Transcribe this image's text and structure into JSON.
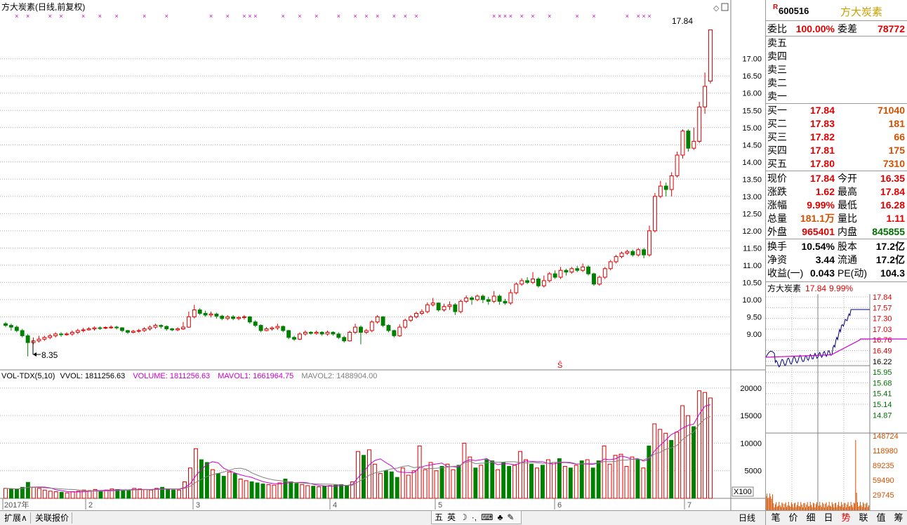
{
  "header": {
    "stock_name": "方大炭素",
    "chart_mode": "(日线,前复权)",
    "r_badge": "R",
    "code": "600516"
  },
  "chart_data": [
    {
      "type": "candlestick",
      "title": "方大炭素(日线,前复权)",
      "y_ticks": [
        9.0,
        9.5,
        10.0,
        10.5,
        11.0,
        11.5,
        12.0,
        12.5,
        13.0,
        13.5,
        14.0,
        14.5,
        15.0,
        15.5,
        16.0,
        16.5,
        17.0
      ],
      "ylim": [
        8.1,
        18.3
      ],
      "annotations": {
        "high_label": "17.84",
        "low_label": "8.35"
      },
      "candles": [
        [
          9.3,
          9.25,
          9.35,
          9.2
        ],
        [
          9.25,
          9.2,
          9.3,
          9.1
        ],
        [
          9.2,
          9.1,
          9.25,
          9.05
        ],
        [
          9.1,
          8.95,
          9.15,
          8.9
        ],
        [
          8.95,
          8.75,
          9.0,
          8.35
        ],
        [
          8.75,
          8.8,
          8.9,
          8.7
        ],
        [
          8.8,
          8.85,
          8.95,
          8.75
        ],
        [
          8.85,
          8.9,
          8.95,
          8.8
        ],
        [
          8.9,
          8.95,
          9.0,
          8.85
        ],
        [
          8.95,
          9.0,
          9.05,
          8.9
        ],
        [
          9.0,
          8.98,
          9.05,
          8.92
        ],
        [
          8.98,
          9.0,
          9.05,
          8.95
        ],
        [
          9.0,
          9.05,
          9.1,
          8.95
        ],
        [
          9.05,
          9.1,
          9.15,
          9.0
        ],
        [
          9.1,
          9.12,
          9.18,
          9.05
        ],
        [
          9.12,
          9.15,
          9.2,
          9.1
        ],
        [
          9.15,
          9.18,
          9.22,
          9.1
        ],
        [
          9.18,
          9.17,
          9.22,
          9.12
        ],
        [
          9.17,
          9.19,
          9.22,
          9.14
        ],
        [
          9.19,
          9.2,
          9.25,
          9.15
        ],
        [
          9.2,
          9.18,
          9.24,
          9.13
        ],
        [
          9.18,
          9.1,
          9.2,
          9.05
        ],
        [
          9.1,
          9.05,
          9.12,
          9.0
        ],
        [
          9.05,
          9.08,
          9.12,
          9.02
        ],
        [
          9.08,
          9.1,
          9.15,
          9.04
        ],
        [
          9.1,
          9.15,
          9.2,
          9.06
        ],
        [
          9.15,
          9.2,
          9.25,
          9.1
        ],
        [
          9.2,
          9.25,
          9.3,
          9.15
        ],
        [
          9.25,
          9.22,
          9.28,
          9.16
        ],
        [
          9.22,
          9.15,
          9.25,
          9.1
        ],
        [
          9.15,
          9.12,
          9.18,
          9.08
        ],
        [
          9.12,
          9.15,
          9.2,
          9.08
        ],
        [
          9.15,
          9.2,
          9.35,
          9.12
        ],
        [
          9.2,
          9.5,
          9.65,
          9.18
        ],
        [
          9.5,
          9.7,
          9.85,
          9.45
        ],
        [
          9.7,
          9.6,
          9.75,
          9.55
        ],
        [
          9.6,
          9.55,
          9.68,
          9.5
        ],
        [
          9.55,
          9.58,
          9.65,
          9.48
        ],
        [
          9.58,
          9.52,
          9.62,
          9.45
        ],
        [
          9.52,
          9.45,
          9.56,
          9.4
        ],
        [
          9.45,
          9.5,
          9.55,
          9.4
        ],
        [
          9.5,
          9.45,
          9.55,
          9.4
        ],
        [
          9.45,
          9.48,
          9.52,
          9.4
        ],
        [
          9.48,
          9.5,
          9.55,
          9.42
        ],
        [
          9.5,
          9.35,
          9.52,
          9.3
        ],
        [
          9.35,
          9.25,
          9.4,
          9.2
        ],
        [
          9.25,
          9.1,
          9.28,
          9.05
        ],
        [
          9.1,
          9.15,
          9.2,
          9.08
        ],
        [
          9.15,
          9.18,
          9.22,
          9.1
        ],
        [
          9.18,
          9.22,
          9.3,
          9.12
        ],
        [
          9.22,
          9.1,
          9.25,
          9.05
        ],
        [
          9.1,
          8.9,
          9.12,
          8.85
        ],
        [
          8.9,
          8.85,
          8.95,
          8.8
        ],
        [
          8.85,
          9.0,
          9.05,
          8.82
        ],
        [
          9.0,
          9.05,
          9.1,
          8.95
        ],
        [
          9.05,
          9.02,
          9.08,
          8.98
        ],
        [
          9.02,
          9.05,
          9.1,
          8.98
        ],
        [
          9.05,
          9.0,
          9.08,
          8.95
        ],
        [
          9.0,
          9.05,
          9.1,
          8.95
        ],
        [
          9.05,
          9.0,
          9.08,
          8.95
        ],
        [
          9.0,
          8.9,
          9.05,
          8.85
        ],
        [
          8.9,
          8.8,
          8.95,
          8.75
        ],
        [
          8.8,
          9.05,
          9.1,
          8.78
        ],
        [
          9.05,
          9.2,
          9.3,
          9.0
        ],
        [
          9.2,
          9.05,
          9.25,
          8.7
        ],
        [
          9.05,
          9.1,
          9.15,
          9.0
        ],
        [
          9.1,
          9.35,
          9.4,
          9.05
        ],
        [
          9.35,
          9.5,
          9.55,
          9.3
        ],
        [
          9.5,
          9.25,
          9.52,
          9.2
        ],
        [
          9.25,
          9.1,
          9.28,
          9.05
        ],
        [
          9.1,
          8.95,
          9.12,
          8.9
        ],
        [
          8.95,
          9.2,
          9.28,
          8.92
        ],
        [
          9.2,
          9.4,
          9.45,
          9.15
        ],
        [
          9.4,
          9.5,
          9.55,
          9.35
        ],
        [
          9.5,
          9.6,
          9.65,
          9.45
        ],
        [
          9.6,
          9.65,
          9.72,
          9.55
        ],
        [
          9.65,
          9.85,
          9.92,
          9.6
        ],
        [
          9.85,
          9.9,
          10.05,
          9.8
        ],
        [
          9.9,
          9.7,
          9.92,
          9.65
        ],
        [
          9.7,
          9.8,
          9.88,
          9.65
        ],
        [
          9.8,
          9.85,
          9.95,
          9.7
        ],
        [
          9.85,
          9.65,
          9.9,
          9.55
        ],
        [
          9.65,
          9.95,
          10.0,
          9.6
        ],
        [
          9.95,
          10.05,
          10.12,
          9.9
        ],
        [
          10.05,
          10.0,
          10.1,
          9.85
        ],
        [
          10.0,
          10.1,
          10.15,
          9.95
        ],
        [
          10.1,
          10.0,
          10.15,
          9.9
        ],
        [
          10.0,
          9.95,
          10.08,
          9.85
        ],
        [
          9.95,
          10.1,
          10.25,
          9.9
        ],
        [
          10.1,
          9.95,
          10.15,
          9.85
        ],
        [
          9.95,
          9.9,
          10.02,
          9.85
        ],
        [
          9.9,
          10.2,
          10.3,
          9.85
        ],
        [
          10.2,
          10.45,
          10.5,
          10.15
        ],
        [
          10.45,
          10.55,
          10.62,
          10.4
        ],
        [
          10.55,
          10.5,
          10.65,
          10.45
        ],
        [
          10.5,
          10.6,
          10.8,
          10.45
        ],
        [
          10.6,
          10.4,
          10.65,
          10.35
        ],
        [
          10.4,
          10.55,
          10.7,
          10.35
        ],
        [
          10.55,
          10.75,
          10.8,
          10.5
        ],
        [
          10.75,
          10.65,
          10.85,
          10.6
        ],
        [
          10.65,
          10.85,
          10.95,
          10.6
        ],
        [
          10.85,
          10.8,
          10.9,
          10.7
        ],
        [
          10.8,
          10.9,
          10.95,
          10.75
        ],
        [
          10.9,
          10.85,
          10.98,
          10.8
        ],
        [
          10.85,
          10.95,
          11.05,
          10.8
        ],
        [
          10.95,
          10.75,
          11.0,
          10.7
        ],
        [
          10.75,
          10.45,
          10.78,
          10.4
        ],
        [
          10.45,
          10.65,
          10.7,
          10.4
        ],
        [
          10.65,
          10.9,
          10.95,
          10.6
        ],
        [
          10.9,
          11.1,
          11.15,
          10.85
        ],
        [
          11.1,
          11.25,
          11.3,
          11.05
        ],
        [
          11.25,
          11.35,
          11.4,
          11.2
        ],
        [
          11.35,
          11.4,
          11.45,
          11.3
        ],
        [
          11.4,
          11.3,
          11.45,
          11.25
        ],
        [
          11.3,
          11.45,
          11.5,
          11.25
        ],
        [
          11.45,
          11.3,
          11.5,
          11.2
        ],
        [
          11.3,
          12.0,
          12.15,
          11.25
        ],
        [
          12.0,
          13.0,
          13.1,
          11.95
        ],
        [
          13.0,
          13.3,
          13.45,
          12.95
        ],
        [
          13.3,
          13.2,
          13.4,
          13.0
        ],
        [
          13.2,
          13.6,
          13.7,
          13.0
        ],
        [
          13.6,
          14.2,
          14.3,
          13.55
        ],
        [
          14.2,
          14.9,
          14.95,
          14.1
        ],
        [
          14.9,
          14.4,
          14.95,
          14.3
        ],
        [
          14.4,
          14.6,
          15.0,
          14.35
        ],
        [
          14.6,
          15.6,
          15.75,
          14.55
        ],
        [
          15.6,
          16.2,
          16.6,
          15.4
        ],
        [
          16.35,
          17.84,
          17.84,
          16.28
        ]
      ],
      "month_labels": [
        "2017年",
        "2",
        "3",
        "4",
        "5",
        "6",
        "7"
      ],
      "tick_labels_text": [
        "9.00",
        "9.50",
        "10.00",
        "10.50",
        "11.00",
        "11.50",
        "12.00",
        "12.50",
        "13.00",
        "13.50",
        "14.00",
        "14.50",
        "15.00",
        "15.50",
        "16.00",
        "16.50",
        "17.00"
      ]
    },
    {
      "type": "bar",
      "title": "VOL-TDX(5,10)",
      "legend": {
        "vvol": "VVOL: 1811256.63",
        "volume": "VOLUME: 1811256.63",
        "mavol1": "MAVOL1: 1661964.75",
        "mavol2": "MAVOL2: 1488904.00"
      },
      "y_ticks": [
        "5000",
        "10000",
        "15000",
        "20000"
      ],
      "unit_label": "X100",
      "volumes": [
        1800,
        1700,
        1600,
        2000,
        2900,
        2000,
        1800,
        1500,
        1300,
        1200,
        1100,
        1000,
        1200,
        1300,
        1500,
        1400,
        1600,
        1300,
        1500,
        1700,
        1600,
        1500,
        1400,
        1800,
        1700,
        1600,
        1500,
        1800,
        2000,
        1700,
        1500,
        1500,
        3000,
        5500,
        9000,
        7000,
        6500,
        5200,
        4500,
        4000,
        4800,
        4500,
        3500,
        3200,
        3000,
        2800,
        2600,
        2500,
        2400,
        2800,
        3500,
        3000,
        2700,
        2500,
        2300,
        2200,
        2100,
        2200,
        2300,
        2400,
        2500,
        2300,
        3000,
        8500,
        7800,
        8800,
        6200,
        4500,
        5000,
        4800,
        3800,
        5500,
        4200,
        5000,
        9500,
        5200,
        6500,
        5000,
        5800,
        6200,
        5200,
        6000,
        10000,
        7500,
        5500,
        6000,
        7000,
        6800,
        5200,
        6500,
        5800,
        6000,
        8500,
        7000,
        6200,
        5500,
        6000,
        7000,
        6500,
        7200,
        5800,
        5500,
        6000,
        6800,
        7000,
        5500,
        6800,
        9500,
        6200,
        7800,
        8000,
        5800,
        7500,
        7000,
        5500,
        9500,
        13500,
        12500,
        11800,
        10500,
        12000,
        16800,
        15000,
        13000,
        19500,
        19200,
        18200
      ],
      "volume_up": [
        true,
        false,
        false,
        false,
        false,
        true,
        true,
        true,
        true,
        true,
        false,
        true,
        true,
        true,
        true,
        true,
        true,
        false,
        true,
        true,
        false,
        false,
        false,
        true,
        true,
        true,
        true,
        true,
        false,
        false,
        false,
        true,
        true,
        true,
        true,
        false,
        false,
        true,
        false,
        false,
        true,
        false,
        true,
        true,
        false,
        false,
        false,
        true,
        true,
        true,
        false,
        false,
        false,
        true,
        true,
        false,
        true,
        false,
        true,
        false,
        false,
        false,
        true,
        true,
        false,
        true,
        true,
        true,
        false,
        false,
        false,
        true,
        true,
        true,
        true,
        true,
        true,
        true,
        false,
        true,
        true,
        false,
        true,
        true,
        false,
        true,
        false,
        false,
        true,
        false,
        false,
        true,
        true,
        true,
        false,
        true,
        false,
        true,
        true,
        false,
        true,
        false,
        true,
        false,
        true,
        false,
        false,
        true,
        true,
        true,
        true,
        true,
        true,
        false,
        true,
        false,
        true,
        true,
        true,
        false,
        true,
        true,
        true,
        false,
        true,
        true,
        true,
        true
      ],
      "ma5": [],
      "ma10": []
    },
    {
      "type": "line",
      "title": "intraday",
      "price_labels": [
        "17.84",
        "17.57",
        "17.30",
        "17.03",
        "16.76",
        "16.49",
        "16.22",
        "15.95",
        "15.68",
        "15.41",
        "15.14",
        "14.87"
      ],
      "vol_labels": [
        "148724",
        "118980",
        "89235",
        "59490",
        "29745"
      ],
      "header_name": "方大炭素",
      "header_price": "17.84",
      "header_pct": "9.99%"
    }
  ],
  "quote": {
    "weibi_label": "委比",
    "weibi": "100.00%",
    "weicha_label": "委差",
    "weicha": "78772",
    "sell": [
      {
        "label": "卖五"
      },
      {
        "label": "卖四"
      },
      {
        "label": "卖三"
      },
      {
        "label": "卖二"
      },
      {
        "label": "卖一"
      }
    ],
    "buy": [
      {
        "label": "买一",
        "price": "17.84",
        "vol": "71040"
      },
      {
        "label": "买二",
        "price": "17.83",
        "vol": "181"
      },
      {
        "label": "买三",
        "price": "17.82",
        "vol": "66"
      },
      {
        "label": "买四",
        "price": "17.81",
        "vol": "175"
      },
      {
        "label": "买五",
        "price": "17.80",
        "vol": "7310"
      }
    ],
    "stats": [
      {
        "l1": "现价",
        "v1": "17.84",
        "c1": "red",
        "l2": "今开",
        "v2": "16.35",
        "c2": "red"
      },
      {
        "l1": "涨跌",
        "v1": "1.62",
        "c1": "red",
        "l2": "最高",
        "v2": "17.84",
        "c2": "red"
      },
      {
        "l1": "涨幅",
        "v1": "9.99%",
        "c1": "red",
        "l2": "最低",
        "v2": "16.28",
        "c2": "red"
      },
      {
        "l1": "总量",
        "v1": "181.1万",
        "c1": "org",
        "l2": "量比",
        "v2": "1.11",
        "c2": "red"
      },
      {
        "l1": "外盘",
        "v1": "965401",
        "c1": "red",
        "l2": "内盘",
        "v2": "845855",
        "c2": "grn"
      }
    ],
    "stats2": [
      {
        "l1": "换手",
        "v1": "10.54%",
        "l2": "股本",
        "v2": "17.2亿"
      },
      {
        "l1": "净资",
        "v1": "3.44",
        "l2": "流通",
        "v2": "17.2亿"
      },
      {
        "l1": "收益(一)",
        "v1": "0.043",
        "l2": "PE(动)",
        "v2": "104.3"
      }
    ]
  },
  "bottom": {
    "tab1": "扩展∧",
    "tab2": "关联报价",
    "period": "日线",
    "ime": [
      "五",
      "英",
      "☽",
      "·,",
      "⌨",
      "♣",
      "✎"
    ],
    "rtabs": [
      "笔",
      "价",
      "细",
      "日",
      "势",
      "联",
      "值",
      "筹"
    ]
  },
  "colors": {
    "up": "#e00000",
    "down": "#008000",
    "ma1": "#cc00cc",
    "ma2": "#808080",
    "grid": "#b0b0b0"
  }
}
